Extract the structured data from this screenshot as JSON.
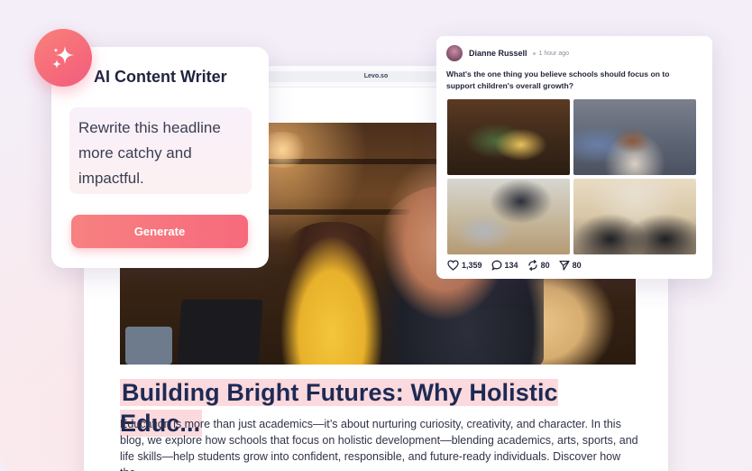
{
  "browser": {
    "url": "Levo.so"
  },
  "blog": {
    "headline": "Building Bright Futures: Why Holistic Educ...",
    "body": "Education is more than just academics—it’s about nurturing curiosity, creativity, and character. In this blog, we explore how schools that focus on holistic development—blending academics, arts, sports, and life skills—help students grow into confident, responsible, and future-ready individuals. Discover how the"
  },
  "ai_writer": {
    "title": "AI Content Writer",
    "prompt": "Rewrite this headline more catchy and impactful.",
    "generate_label": "Generate",
    "badge_icon": "sparkle-icon"
  },
  "post": {
    "author": "Dianne Russell",
    "time": "1 hour ago",
    "text": "What's the one thing you believe schools should focus on to support children's overall growth?",
    "stats": {
      "likes": "1,359",
      "comments": "134",
      "reposts": "80",
      "shares": "80"
    }
  },
  "colors": {
    "headline_highlight": "#fbd9dc",
    "headline_text": "#1d2a55",
    "accent_gradient_start": "#f78181",
    "accent_gradient_end": "#f76a7c"
  }
}
